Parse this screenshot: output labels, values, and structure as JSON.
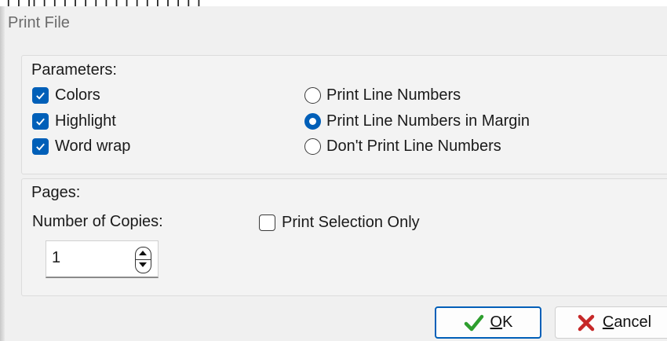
{
  "window": {
    "title": "Print File"
  },
  "parameters": {
    "label": "Parameters:",
    "checkboxes": [
      {
        "label": "Colors",
        "checked": true
      },
      {
        "label": "Highlight",
        "checked": true
      },
      {
        "label": "Word wrap",
        "checked": true
      }
    ],
    "line_numbers": [
      {
        "label": "Print Line Numbers",
        "selected": false
      },
      {
        "label": "Print Line Numbers in Margin",
        "selected": true
      },
      {
        "label": "Don't Print Line Numbers",
        "selected": false
      }
    ]
  },
  "pages": {
    "label": "Pages:",
    "copies_label": "Number of Copies:",
    "copies_value": "1",
    "selection_only": {
      "label": "Print Selection Only",
      "checked": false
    }
  },
  "buttons": {
    "ok": {
      "accel": "O",
      "rest": "K",
      "icon": "checkmark-icon"
    },
    "cancel": {
      "accel": "C",
      "rest": "ancel",
      "icon": "x-icon"
    }
  },
  "colors": {
    "accent": "#005fb8",
    "ok_check": "#2e9e2e",
    "cancel_x": "#c62828"
  }
}
